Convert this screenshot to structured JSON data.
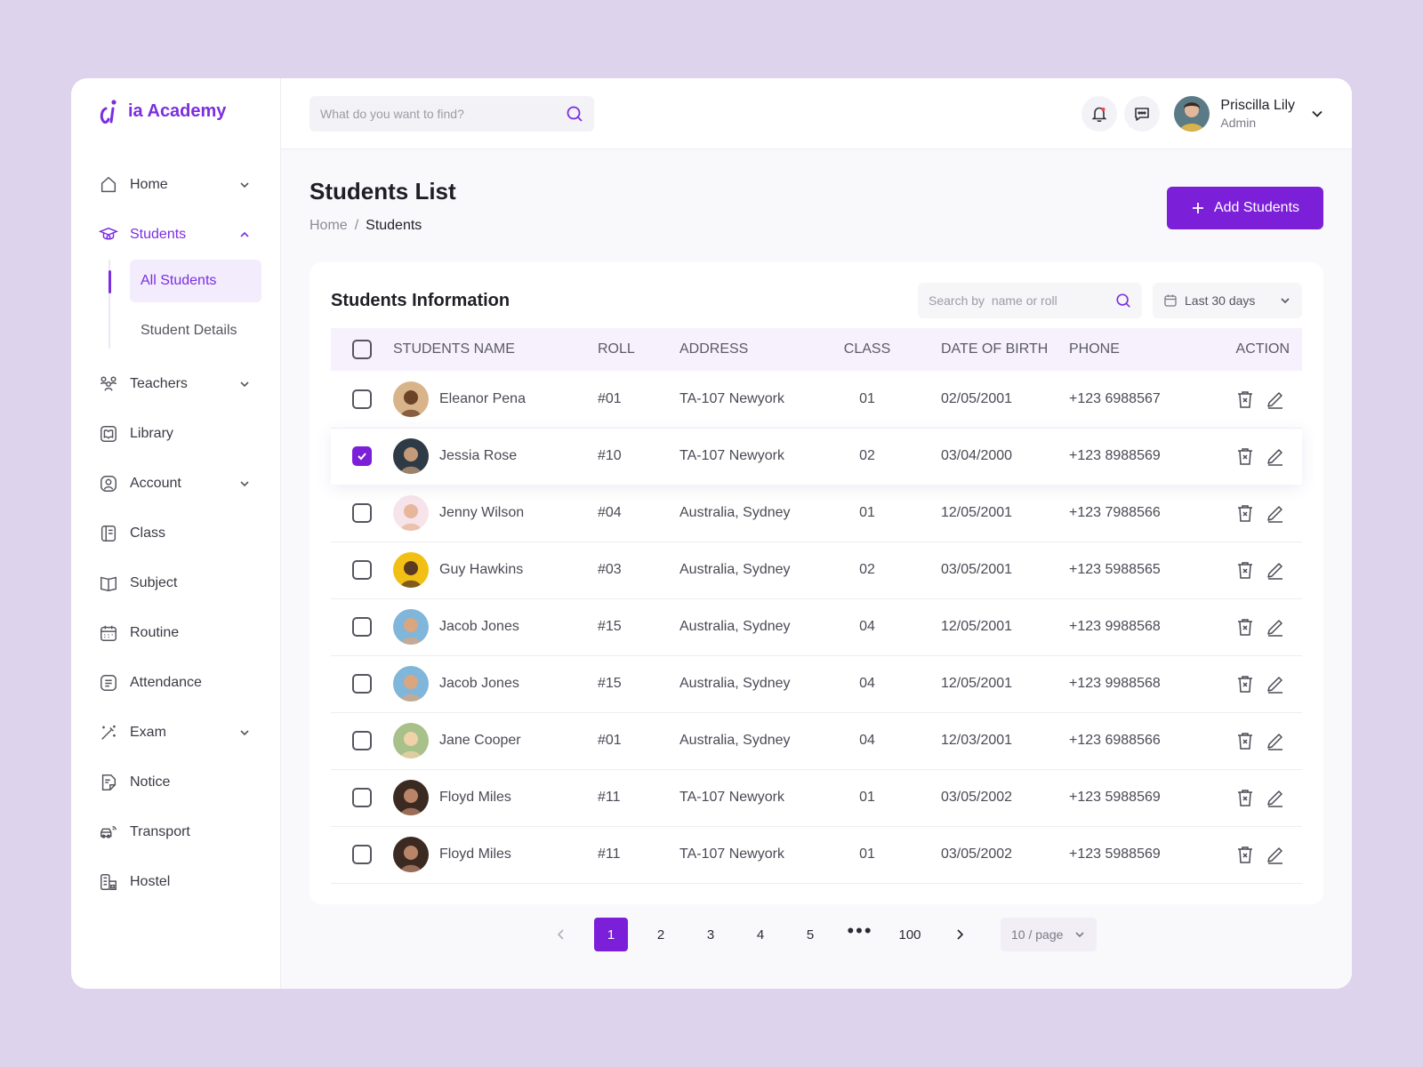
{
  "brand": {
    "name": "ia Academy",
    "color": "#7b2ee0"
  },
  "search": {
    "placeholder": "What do you want to find?"
  },
  "user": {
    "name": "Priscilla Lily",
    "role": "Admin"
  },
  "sidebar": {
    "items": [
      {
        "label": "Home",
        "icon": "home-icon",
        "chevron": "down"
      },
      {
        "label": "Students",
        "icon": "graduate-icon",
        "chevron": "up",
        "active": true,
        "sub": [
          {
            "label": "All Students",
            "active": true
          },
          {
            "label": "Student Details"
          }
        ]
      },
      {
        "label": "Teachers",
        "icon": "teachers-icon",
        "chevron": "down"
      },
      {
        "label": "Library",
        "icon": "library-icon"
      },
      {
        "label": "Account",
        "icon": "account-icon",
        "chevron": "down"
      },
      {
        "label": "Class",
        "icon": "class-icon"
      },
      {
        "label": "Subject",
        "icon": "subject-icon"
      },
      {
        "label": "Routine",
        "icon": "calendar-icon"
      },
      {
        "label": "Attendance",
        "icon": "attendance-icon"
      },
      {
        "label": "Exam",
        "icon": "exam-icon",
        "chevron": "down"
      },
      {
        "label": "Notice",
        "icon": "notice-icon"
      },
      {
        "label": "Transport",
        "icon": "transport-icon"
      },
      {
        "label": "Hostel",
        "icon": "hostel-icon"
      }
    ]
  },
  "page": {
    "title": "Students List",
    "breadcrumb": {
      "home": "Home",
      "sep": "/",
      "current": "Students"
    },
    "add_button": "Add Students"
  },
  "table": {
    "title": "Students Information",
    "search_placeholder": "Search by  name or roll",
    "date_filter": "Last 30 days",
    "headers": [
      "STUDENTS NAME",
      "ROLL",
      "ADDRESS",
      "CLASS",
      "DATE OF BIRTH",
      "PHONE",
      "ACTION"
    ],
    "rows": [
      {
        "name": "Eleanor Pena",
        "roll": "#01",
        "address": "TA-107 Newyork",
        "class": "01",
        "dob": "02/05/2001",
        "phone": "+123 6988567",
        "checked": false,
        "avatar_bg": "#d9b48a",
        "avatar_fg": "#6b4326"
      },
      {
        "name": "Jessia Rose",
        "roll": "#10",
        "address": "TA-107 Newyork",
        "class": "02",
        "dob": "03/04/2000",
        "phone": "+123 8988569",
        "checked": true,
        "avatar_bg": "#2e3a46",
        "avatar_fg": "#c49a78"
      },
      {
        "name": "Jenny Wilson",
        "roll": "#04",
        "address": "Australia, Sydney",
        "class": "01",
        "dob": "12/05/2001",
        "phone": "+123 7988566",
        "checked": false,
        "avatar_bg": "#f6e4ea",
        "avatar_fg": "#e8b79b"
      },
      {
        "name": "Guy Hawkins",
        "roll": "#03",
        "address": "Australia, Sydney",
        "class": "02",
        "dob": "03/05/2001",
        "phone": "+123 5988565",
        "checked": false,
        "avatar_bg": "#f2c015",
        "avatar_fg": "#5b3a22"
      },
      {
        "name": "Jacob Jones",
        "roll": "#15",
        "address": "Australia, Sydney",
        "class": "04",
        "dob": "12/05/2001",
        "phone": "+123 9988568",
        "checked": false,
        "avatar_bg": "#7fb6d9",
        "avatar_fg": "#d9a680"
      },
      {
        "name": "Jacob Jones",
        "roll": "#15",
        "address": "Australia, Sydney",
        "class": "04",
        "dob": "12/05/2001",
        "phone": "+123 9988568",
        "checked": false,
        "avatar_bg": "#7fb6d9",
        "avatar_fg": "#d9a680"
      },
      {
        "name": "Jane Cooper",
        "roll": "#01",
        "address": "Australia, Sydney",
        "class": "04",
        "dob": "12/03/2001",
        "phone": "+123 6988566",
        "checked": false,
        "avatar_bg": "#a8c08a",
        "avatar_fg": "#f0d2a8"
      },
      {
        "name": "Floyd Miles",
        "roll": "#11",
        "address": "TA-107 Newyork",
        "class": "01",
        "dob": "03/05/2002",
        "phone": "+123 5988569",
        "checked": false,
        "avatar_bg": "#3a2a22",
        "avatar_fg": "#b98468"
      },
      {
        "name": "Floyd Miles",
        "roll": "#11",
        "address": "TA-107 Newyork",
        "class": "01",
        "dob": "03/05/2002",
        "phone": "+123 5988569",
        "checked": false,
        "avatar_bg": "#3a2a22",
        "avatar_fg": "#b98468"
      }
    ]
  },
  "pagination": {
    "pages": [
      "1",
      "2",
      "3",
      "4",
      "5"
    ],
    "current": "1",
    "last": "100",
    "per_page": "10 / page"
  }
}
